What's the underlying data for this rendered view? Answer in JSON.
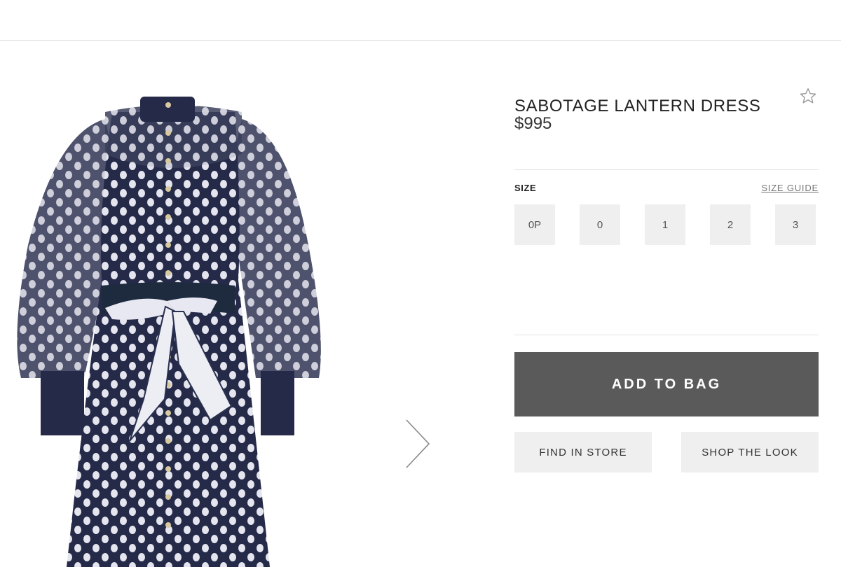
{
  "product": {
    "title": "SABOTAGE LANTERN DRESS",
    "price": "$995",
    "favorite_icon": "star-outline-icon",
    "image_alt": "Navy polka dot lantern-sleeve dress with scarf tie belt"
  },
  "size": {
    "label": "SIZE",
    "guide_link": "SIZE GUIDE",
    "options": [
      "0P",
      "0",
      "1",
      "2",
      "3"
    ]
  },
  "actions": {
    "add_to_bag": "ADD TO BAG",
    "find_in_store": "FIND IN STORE",
    "shop_the_look": "SHOP THE LOOK"
  },
  "gallery": {
    "next_icon": "chevron-right-icon"
  },
  "colors": {
    "dress_navy": "#252a48",
    "dot": "#e4e5ee",
    "primary_button": "#5a5a5a",
    "secondary_button": "#efefef"
  }
}
